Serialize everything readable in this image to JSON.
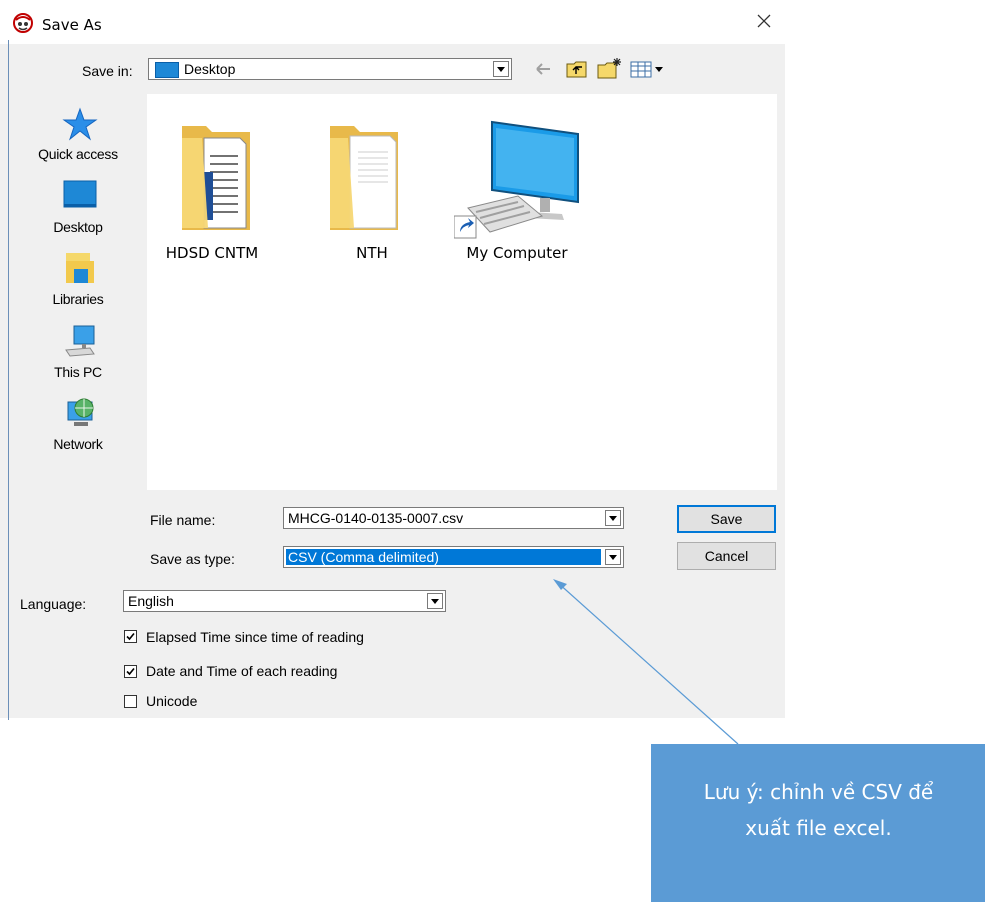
{
  "window": {
    "title": "Save As"
  },
  "toolbar": {
    "save_in_label": "Save in:",
    "save_in_value": "Desktop"
  },
  "places": [
    {
      "label": "Quick access",
      "icon": "star-icon"
    },
    {
      "label": "Desktop",
      "icon": "desktop-icon"
    },
    {
      "label": "Libraries",
      "icon": "libraries-icon"
    },
    {
      "label": "This PC",
      "icon": "computer-icon"
    },
    {
      "label": "Network",
      "icon": "network-icon"
    }
  ],
  "files": [
    {
      "name": "HDSD CNTM",
      "type": "folder"
    },
    {
      "name": "NTH",
      "type": "folder"
    },
    {
      "name": "My Computer",
      "type": "shortcut"
    }
  ],
  "form": {
    "file_name_label": "File name:",
    "file_name_value": "MHCG-0140-0135-0007.csv",
    "save_as_type_label": "Save as type:",
    "save_as_type_value": "CSV (Comma delimited)",
    "save_button": "Save",
    "cancel_button": "Cancel"
  },
  "options": {
    "language_label": "Language:",
    "language_value": "English",
    "checkboxes": [
      {
        "label": "Elapsed Time since time of reading",
        "checked": true
      },
      {
        "label": "Date and Time of each reading",
        "checked": true
      },
      {
        "label": "Unicode",
        "checked": false
      }
    ]
  },
  "annotation": {
    "line1": "Lưu ý: chỉnh về CSV để",
    "line2": "xuất file excel."
  },
  "colors": {
    "selection": "#0078d7",
    "callout": "#5b9bd5",
    "folder": "#f7d774"
  }
}
